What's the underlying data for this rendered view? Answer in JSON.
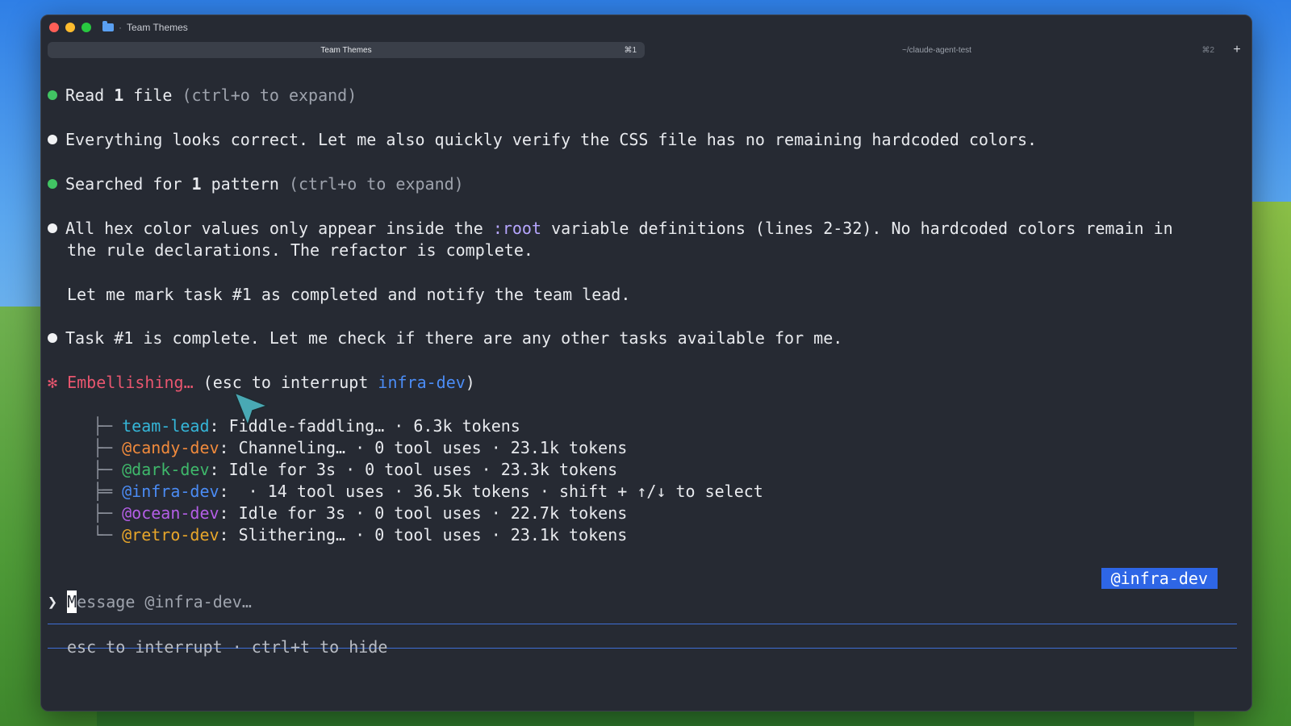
{
  "window": {
    "title": "Team Themes",
    "tabs": [
      {
        "label": "Team Themes",
        "shortcut": "⌘1"
      },
      {
        "label": "~/claude-agent-test",
        "shortcut": "⌘2"
      }
    ],
    "new_tab_label": "+"
  },
  "log": {
    "read_file": {
      "prefix": "Read ",
      "count": "1",
      "suffix": " file ",
      "hint": "(ctrl+o to expand)"
    },
    "msg1": "Everything looks correct. Let me also quickly verify the CSS file has no remaining hardcoded colors.",
    "searched": {
      "prefix": "Searched for ",
      "count": "1",
      "suffix": " pattern ",
      "hint": "(ctrl+o to expand)"
    },
    "msg2_a": "All hex color values only appear inside the ",
    "msg2_code": ":root",
    "msg2_b": " variable definitions (lines 2-32). No hardcoded colors remain in",
    "msg2_c": "the rule declarations. The refactor is complete.",
    "msg3": "Let me mark task #1 as completed and notify the team lead.",
    "msg4": "Task #1 is complete. Let me check if there are any other tasks available for me.",
    "status": {
      "star": "✻",
      "verb": "Embellishing…",
      "paren_open": " (esc to interrupt ",
      "agent": "infra-dev",
      "paren_close": ")"
    }
  },
  "agents": [
    {
      "tree": "├─ ",
      "name": "team-lead",
      "detail": ": Fiddle-faddling… · 6.3k tokens"
    },
    {
      "tree": "├─ ",
      "name": "@candy-dev",
      "detail": ": Channeling… · 0 tool uses · 23.1k tokens"
    },
    {
      "tree": "├─ ",
      "name": "@dark-dev",
      "detail": ": Idle for 3s · 0 tool uses · 23.3k tokens"
    },
    {
      "tree": "╞═ ",
      "name": "@infra-dev",
      "detail": ":  · 14 tool uses · 36.5k tokens · shift + ↑/↓ to select"
    },
    {
      "tree": "├─ ",
      "name": "@ocean-dev",
      "detail": ": Idle for 3s · 0 tool uses · 22.7k tokens"
    },
    {
      "tree": "└─ ",
      "name": "@retro-dev",
      "detail": ": Slithering… · 0 tool uses · 23.1k tokens"
    }
  ],
  "input": {
    "badge": "@infra-dev",
    "prompt_symbol": "❯ ",
    "placeholder_first": "M",
    "placeholder_rest": "essage @infra-dev…"
  },
  "footer": "esc to interrupt · ctrl+t to hide",
  "colors": {
    "accent": "#2e66e6",
    "team_lead": "#35b6d8",
    "candy": "#f08a3c",
    "dark": "#3fb86b",
    "infra": "#4b8cf5",
    "ocean": "#b45ee6",
    "retro": "#e8a62a"
  }
}
